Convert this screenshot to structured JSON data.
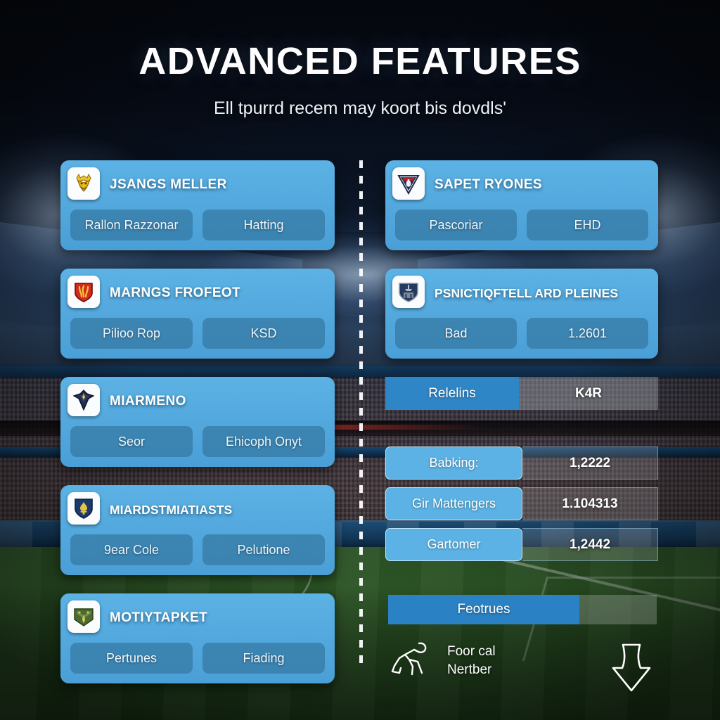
{
  "header": {
    "title": "ADVANCED FEATURES",
    "subtitle": "Ell tpurrd recem may koort bis dovdls'"
  },
  "theme": {
    "card_blue": "#5cb2e4",
    "chip_blue": "#3478a2",
    "accent_blue": "#2a82c4",
    "text_white": "#ffffff",
    "divider_white": "#fcfdff",
    "pitch_green": "#36682e"
  },
  "left_column": {
    "cards": [
      {
        "crest": "stag-crest-icon",
        "crest_colors": [
          "#f2c230",
          "#c8920f"
        ],
        "title": "JSANGS MELLER",
        "chips": [
          "Rallon Razzonar",
          "Hatting"
        ]
      },
      {
        "crest": "flame-shield-icon",
        "crest_colors": [
          "#d12a1e",
          "#8e1109"
        ],
        "title": "MARNGS FROFEOT",
        "chips": [
          "Pilioo Rop",
          "KSD"
        ]
      },
      {
        "crest": "eagle-crest-icon",
        "crest_colors": [
          "#1d2a4a",
          "#c9a227"
        ],
        "title": "MIARMENO",
        "chips": [
          "Seor",
          "Ehicoph Onyt"
        ]
      },
      {
        "crest": "fleur-shield-icon",
        "crest_colors": [
          "#1b3a6b",
          "#e8c244"
        ],
        "title": "MIARDSTMIATIASTS",
        "chips": [
          "9ear Cole",
          "Pelutione"
        ]
      },
      {
        "crest": "green-chevron-icon",
        "crest_colors": [
          "#4a6b32",
          "#d9c75a"
        ],
        "title": "MOTIYTAPKET",
        "chips": [
          "Pertunes",
          "Fiading"
        ]
      }
    ]
  },
  "right_column": {
    "cards": [
      {
        "crest": "triangle-crest-icon",
        "crest_colors": [
          "#1e2c52",
          "#b0222c"
        ],
        "title": "SAPET RYONES",
        "chips": [
          "Pascoriar",
          "EHD"
        ]
      },
      {
        "crest": "castle-shield-icon",
        "crest_colors": [
          "#243a5e",
          "#8c98a8"
        ],
        "title": "PSNICTIQFTELL ARD PLEINES",
        "chips": [
          "Bad",
          "1.2601"
        ]
      }
    ],
    "standalone_row": {
      "label": "Relelins",
      "value": "K4R"
    },
    "stat_rows": [
      {
        "label": "Babking:",
        "value": "1,2222"
      },
      {
        "label": "Gir Mattengers",
        "value": "1.104313"
      },
      {
        "label": "Gartomer",
        "value": "1,2442"
      }
    ],
    "footer_bar": {
      "label": "Feotrues"
    },
    "footer_icons": {
      "figure_icon": "kicking-figure-icon",
      "figure_label_line1": "Foor cal",
      "figure_label_line2": "Nertber",
      "arrow_icon": "down-arrow-icon"
    }
  }
}
